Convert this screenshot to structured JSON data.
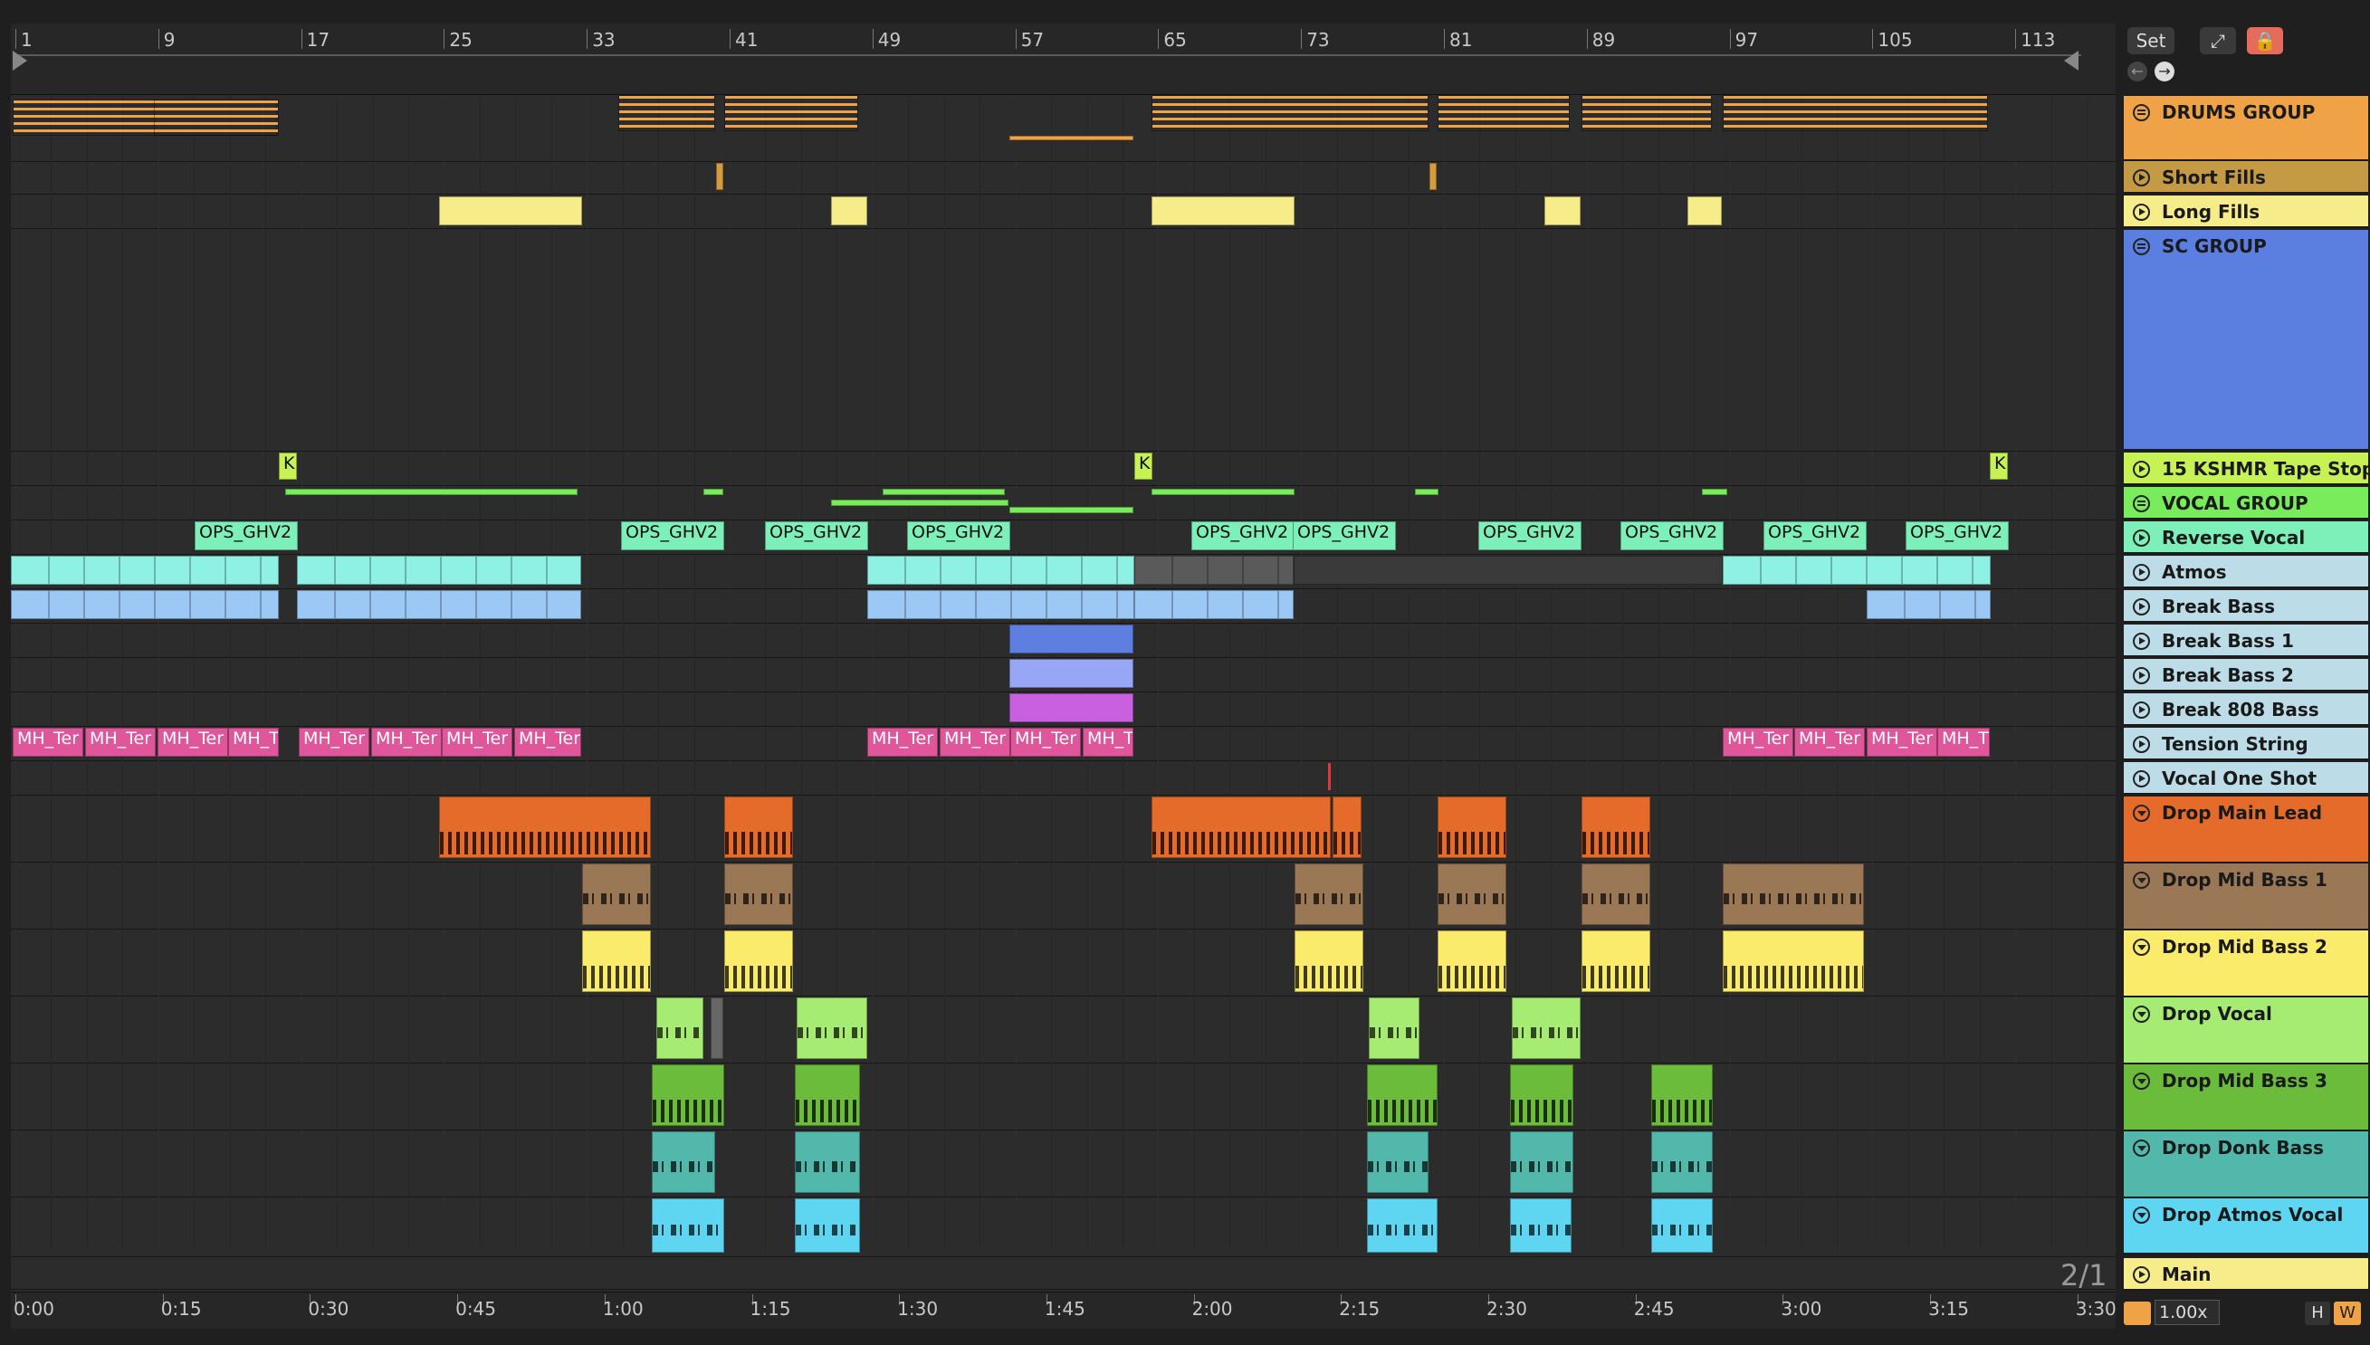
{
  "ruler": {
    "bars": [
      "1",
      "9",
      "17",
      "25",
      "33",
      "41",
      "49",
      "57",
      "65",
      "73",
      "81",
      "89",
      "97",
      "105",
      "113"
    ]
  },
  "timeline": {
    "labels": [
      "0:00",
      "0:15",
      "0:30",
      "0:45",
      "1:00",
      "1:15",
      "1:30",
      "1:45",
      "2:00",
      "2:15",
      "2:30",
      "2:45",
      "3:00",
      "3:15",
      "3:30"
    ]
  },
  "header": {
    "set_label": "Set",
    "expand_icon": "expand-icon",
    "lock_icon": "lock-icon",
    "back_icon": "arrow-left-icon",
    "forward_icon": "arrow-right-icon"
  },
  "tracks": [
    {
      "name": "DRUMS GROUP",
      "color": "#f0a346",
      "icon": "group-icon"
    },
    {
      "name": "Short Fills",
      "color": "#c49a44",
      "icon": "play-icon"
    },
    {
      "name": "Long Fills",
      "color": "#f6ec8a",
      "icon": "play-icon"
    },
    {
      "name": "SC GROUP",
      "color": "#5b7fe0",
      "icon": "group-icon"
    },
    {
      "name": "15 KSHMR Tape Stop",
      "color": "#c6f256",
      "icon": "play-icon"
    },
    {
      "name": "VOCAL GROUP",
      "color": "#78ec5a",
      "icon": "group-icon"
    },
    {
      "name": "Reverse Vocal",
      "color": "#7cf0b8",
      "icon": "play-icon"
    },
    {
      "name": "Atmos",
      "color": "#bcdce8",
      "icon": "play-icon"
    },
    {
      "name": "Break Bass",
      "color": "#bcdce8",
      "icon": "play-icon"
    },
    {
      "name": "Break Bass 1",
      "color": "#bcdce8",
      "icon": "play-icon"
    },
    {
      "name": "Break Bass 2",
      "color": "#bcdce8",
      "icon": "play-icon"
    },
    {
      "name": "Break 808 Bass",
      "color": "#bcdce8",
      "icon": "play-icon"
    },
    {
      "name": "Tension String",
      "color": "#bcdce8",
      "icon": "play-icon"
    },
    {
      "name": "Vocal One Shot",
      "color": "#bcdce8",
      "icon": "play-icon"
    },
    {
      "name": "Drop Main Lead",
      "color": "#e56b2b",
      "icon": "fold-icon"
    },
    {
      "name": "Drop Mid Bass 1",
      "color": "#9b7855",
      "icon": "fold-icon"
    },
    {
      "name": "Drop Mid Bass 2",
      "color": "#fbeb6b",
      "icon": "fold-icon"
    },
    {
      "name": "Drop Vocal",
      "color": "#a6ec72",
      "icon": "fold-icon"
    },
    {
      "name": "Drop Mid Bass 3",
      "color": "#6cbc3c",
      "icon": "fold-icon"
    },
    {
      "name": "Drop Donk Bass",
      "color": "#52b8ac",
      "icon": "fold-icon"
    },
    {
      "name": "Drop Atmos Vocal",
      "color": "#5ed6f2",
      "icon": "fold-icon"
    },
    {
      "name": "Main",
      "color": "#f6ec8a",
      "icon": "play-icon"
    }
  ],
  "clip_labels": {
    "kshmr": "K",
    "reverse": "OPS_GHV2",
    "tension": "MH_Ter",
    "tension_short": "MH_T"
  },
  "footer": {
    "page_indicator": "2/1",
    "zoom": "1.00x",
    "h_label": "H",
    "w_label": "W",
    "waveform_icon": "waveform-icon"
  },
  "colors": {
    "drums": "#f0a346",
    "short_fills": "#d69c3c",
    "long_fills": "#f6ec8a",
    "kshmr": "#c6f256",
    "vocal_line": "#78ec5a",
    "reverse": "#7cf0b8",
    "atmos": "#8ff0e4",
    "break_bass": "#9cc8f5",
    "break_bass1": "#5f7fe0",
    "break_bass2": "#97a7f5",
    "break808": "#c860e0",
    "tension": "#e0569a",
    "main_lead": "#e56b2b",
    "mid_bass1": "#9b7855",
    "mid_bass2": "#fbeb6b",
    "drop_vocal": "#a6ec72",
    "mid_bass3": "#6cbc3c",
    "donk": "#52b8ac",
    "atmos_vocal": "#5ed6f2",
    "playhead": "#e0373a"
  }
}
